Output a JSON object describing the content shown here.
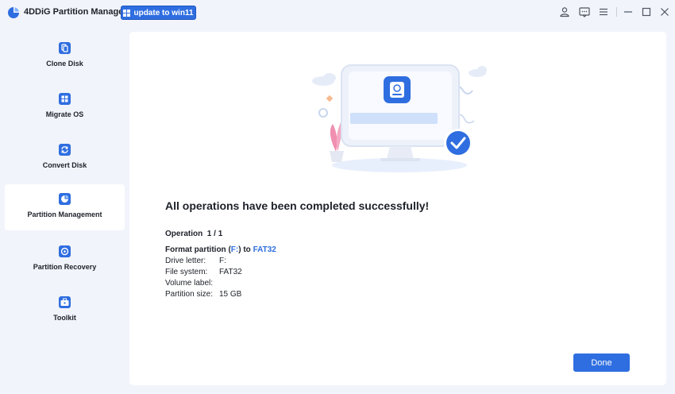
{
  "app": {
    "title": "4DDiG Partition Manager",
    "update_label": "update to win11",
    "accent_color": "#2f6ee0"
  },
  "titlebar_icons": [
    "user-icon",
    "feedback-icon",
    "menu-icon",
    "minimize-icon",
    "maximize-icon",
    "close-icon"
  ],
  "sidebar": {
    "items": [
      {
        "label": "Clone Disk",
        "icon": "clone-disk-icon",
        "active": false
      },
      {
        "label": "Migrate OS",
        "icon": "migrate-os-icon",
        "active": false
      },
      {
        "label": "Convert Disk",
        "icon": "convert-disk-icon",
        "active": false
      },
      {
        "label": "Partition Management",
        "icon": "partition-management-icon",
        "active": true
      },
      {
        "label": "Partition Recovery",
        "icon": "partition-recovery-icon",
        "active": false
      },
      {
        "label": "Toolkit",
        "icon": "toolkit-icon",
        "active": false
      }
    ]
  },
  "main": {
    "headline": "All operations have been completed successfully!",
    "operation_label": "Operation",
    "operation_count": "1 / 1",
    "op": {
      "prefix": "Format partition (",
      "drive": "F:",
      "middle": ") to ",
      "fs": "FAT32"
    },
    "details": [
      {
        "key": "Drive letter:",
        "value": "F:"
      },
      {
        "key": "File system:",
        "value": "FAT32"
      },
      {
        "key": "Volume label:",
        "value": ""
      },
      {
        "key": "Partition size:",
        "value": "15 GB"
      }
    ],
    "done_label": "Done"
  }
}
